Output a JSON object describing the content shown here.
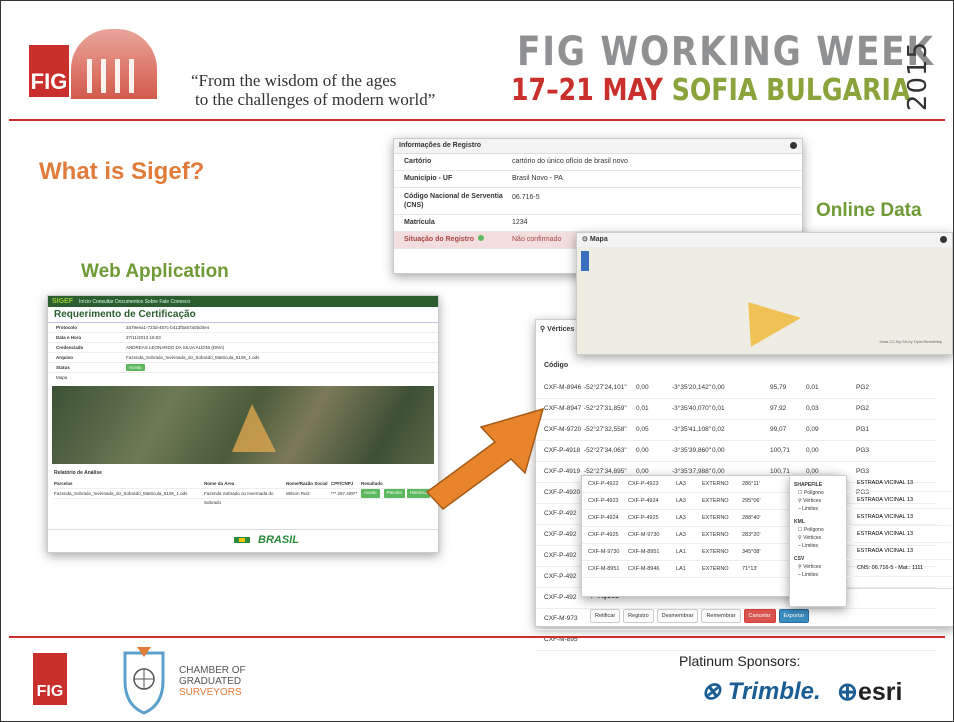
{
  "header": {
    "fig_logo": "FIG",
    "quote_line1": "“From the wisdom of the ages",
    "quote_line2": "to the challenges of modern world”",
    "event_title": "FIG WORKING WEEK",
    "event_dates_red": "17–21 MAY",
    "event_dates_green": "SOFIA BULGARIA",
    "event_year": "2015"
  },
  "slide": {
    "title": "What is Sigef?",
    "web_label": "Web Application",
    "online_label": "Online Data"
  },
  "web_app": {
    "nav_brand": "SIGEF",
    "nav_items": "Início   Consultar   Documentos   Sobre   Fale Conosco",
    "title": "Requerimento de Certificação",
    "rows": [
      {
        "k": "Protocolo",
        "v": "2a79eea1-723d-467c-b413f5a67a0bd4e4"
      },
      {
        "k": "Data e Hora",
        "v": "27/11/2013 16:03"
      },
      {
        "k": "Credenciado",
        "v": "ANDREAS LEONARDO DA SILVA ALDINI (DMA)"
      },
      {
        "k": "Arquivo",
        "v": "Fazenda_Sobrado_Invernada_do_Sobrado_Matricula_5106_1.ods"
      },
      {
        "k": "Status",
        "v": "Aceito"
      }
    ],
    "map_label": "Mapa",
    "analysis_title": "Relatório de Análise",
    "analysis_cols": [
      "Parcelas",
      "Nome da Área",
      "Nome/Razão Social",
      "CPF/CNPJ",
      "Resultado"
    ],
    "analysis_row": [
      "Fazenda_Sobrado_Invernada_do_Sobrado_Matricula_5106_1.ods",
      "Fazenda Sobrado ou Invernada do Sobrado",
      "Wilson Ruiz",
      "***.267.409**",
      "Aceito"
    ],
    "btn_parcela": "Parcela",
    "btn_historico": "Histórico",
    "footer_brand": "BRASIL"
  },
  "registro": {
    "title": "Informações de Registro",
    "rows": [
      {
        "k": "Cartório",
        "v": "cartório do único ofício de brasil novo"
      },
      {
        "k": "Município - UF",
        "v": "Brasil Novo - PA"
      },
      {
        "k": "Código Nacional de Serventia (CNS)",
        "v": "06.716-5"
      },
      {
        "k": "Matrícula",
        "v": "1234"
      },
      {
        "k": "Situação do Registro",
        "v": "Não confirmado"
      }
    ]
  },
  "mapa": {
    "title": "Mapa",
    "attribution": "Data CC-By-SA by OpenStreetMap"
  },
  "vertices": {
    "title": "Vértices",
    "col_code": "Código",
    "rows": [
      [
        "CXF-M-8946",
        "-52°27'24,101\"",
        "0,00",
        "-3°35'20,142\"",
        "0,00",
        "95,79",
        "0,01",
        "PG2"
      ],
      [
        "CXF-M-8947",
        "-52°27'31,859\"",
        "0,01",
        "-3°35'40,070\"",
        "0,01",
        "97,92",
        "0,03",
        "PG2"
      ],
      [
        "CXF-M-9720",
        "-52°27'32,558\"",
        "0,05",
        "-3°35'41,108\"",
        "0,02",
        "99,07",
        "0,09",
        "PG1"
      ],
      [
        "CXF-P-4918",
        "-52°27'34,063\"",
        "0,00",
        "-3°35'39,860\"",
        "0,00",
        "100,71",
        "0,00",
        "PG3"
      ],
      [
        "CXF-P-4919",
        "-52°27'34,895\"",
        "0,00",
        "-3°35'37,988\"",
        "0,00",
        "100,71",
        "0,00",
        "PG3"
      ],
      [
        "CXF-P-4920",
        "-52°27'35,922\"",
        "0,00",
        "-3°35'36,842\"",
        "0,00",
        "100,71",
        "0,00",
        "PG3"
      ],
      [
        "CXF-P-492"
      ],
      [
        "CXF-P-492"
      ],
      [
        "CXF-P-492"
      ],
      [
        "CXF-P-492"
      ],
      [
        "CXF-P-492"
      ],
      [
        "CXF-M-973"
      ],
      [
        "CXF-M-895"
      ]
    ],
    "limites": [
      [
        "CXF-P-4922",
        "CXF-P-4923",
        "LA3",
        "EXTERNO",
        "286°11'"
      ],
      [
        "CXF-P-4923",
        "CXF-P-4924",
        "LA3",
        "EXTERNO",
        "295°06'"
      ],
      [
        "CXF-P-4924",
        "CXF-P-4925",
        "LA3",
        "EXTERNO",
        "288°40'"
      ],
      [
        "CXF-P-4925",
        "CXF-M-9730",
        "LA3",
        "EXTERNO",
        "283°20'"
      ],
      [
        "CXF-M-9730",
        "CXF-M-8951",
        "LA1",
        "EXTERNO",
        "345°08'"
      ],
      [
        "CXF-M-8951",
        "CXF-M-8946",
        "LA1",
        "EXTERNO",
        "71°13'"
      ]
    ],
    "export_menu": {
      "shapefile": "SHAPEFILE",
      "kml": "KML",
      "csv": "CSV",
      "poligono": "Polígono",
      "vertices": "Vértices",
      "limites": "Limites"
    },
    "estrada": [
      "ESTRADA VICINAL 13",
      "ESTRADA VICINAL 13",
      "ESTRADA VICINAL 13",
      "ESTRADA VICINAL 13",
      "ESTRADA VICINAL 13",
      "CNS: 06.716-5 - Mat.: 1111"
    ],
    "acoes_title": "Ações",
    "buttons": [
      "Retificar",
      "Registro",
      "Desmembrar",
      "Remembrar",
      "Cancelar",
      "Exportar"
    ]
  },
  "footer": {
    "fig_logo": "FIG",
    "cgs_line1": "CHAMBER OF",
    "cgs_line2": "GRADUATED",
    "cgs_line3": "SURVEYORS",
    "platinum": "Platinum Sponsors:",
    "trimble": "Trimble.",
    "esri": "esri"
  },
  "colors": {
    "fig_red": "#c9302c",
    "title_orange": "#e07b39",
    "label_green": "#6f9a35",
    "arrow_orange": "#e8852c"
  }
}
